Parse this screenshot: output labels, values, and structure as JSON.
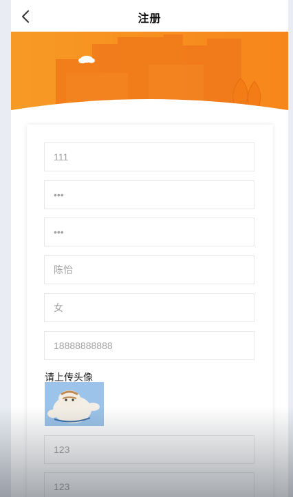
{
  "header": {
    "title": "注册"
  },
  "form": {
    "fields": [
      {
        "name": "username",
        "value": "111"
      },
      {
        "name": "password",
        "value": "•••"
      },
      {
        "name": "confirm-password",
        "value": "•••"
      },
      {
        "name": "real-name",
        "value": "陈怡"
      },
      {
        "name": "gender",
        "value": "女"
      },
      {
        "name": "phone",
        "value": "18888888888"
      }
    ],
    "upload_label": "请上传头像",
    "extra_fields": [
      {
        "name": "extra-field-1",
        "value": "123"
      },
      {
        "name": "extra-field-2",
        "value": "123"
      }
    ]
  },
  "colors": {
    "banner_orange": "#f7941d",
    "card_border": "#e6e6e6"
  },
  "icons": {
    "back": "chevron-left-icon"
  }
}
